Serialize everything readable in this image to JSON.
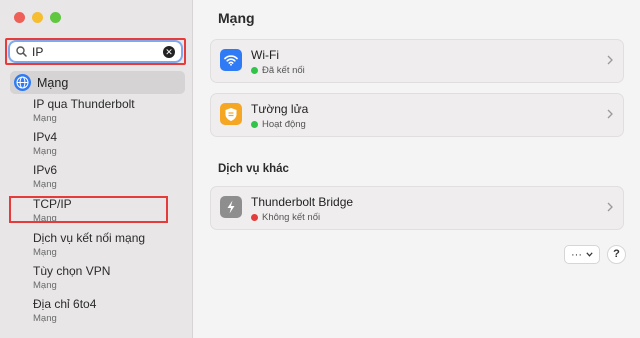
{
  "window": {
    "traffic_colors": [
      "#ee5f57",
      "#f5bd2f",
      "#5fc83f"
    ]
  },
  "search": {
    "value": "IP",
    "clear_icon": "clear-icon"
  },
  "sidebar": {
    "selected": {
      "label": "Mạng",
      "icon": "globe-icon"
    },
    "results": [
      {
        "title": "IP qua Thunderbolt",
        "subtitle": "Mạng"
      },
      {
        "title": "IPv4",
        "subtitle": "Mạng"
      },
      {
        "title": "IPv6",
        "subtitle": "Mạng"
      },
      {
        "title": "TCP/IP",
        "subtitle": "Mạng"
      },
      {
        "title": "Dịch vụ kết nối mạng",
        "subtitle": "Mạng"
      },
      {
        "title": "Tùy chọn VPN",
        "subtitle": "Mạng"
      },
      {
        "title": "Địa chỉ 6to4",
        "subtitle": "Mạng"
      }
    ]
  },
  "main": {
    "title": "Mạng",
    "services": [
      {
        "name": "Wi-Fi",
        "status": "Đã kết nối",
        "status_color": "#33c24a",
        "icon": "wifi-icon",
        "icon_bg": "#2f7bf5"
      },
      {
        "name": "Tường lửa",
        "status": "Hoạt động",
        "status_color": "#33c24a",
        "icon": "firewall-icon",
        "icon_bg": "#f5a623"
      }
    ],
    "other_title": "Dịch vụ khác",
    "other_services": [
      {
        "name": "Thunderbolt Bridge",
        "status": "Không kết nối",
        "status_color": "#e53b3b",
        "icon": "thunderbolt-icon",
        "icon_bg": "#8e8e8e"
      }
    ],
    "more_label": "···",
    "help_label": "?"
  }
}
